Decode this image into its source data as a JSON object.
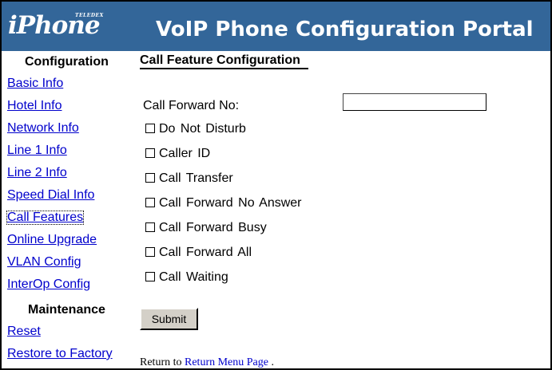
{
  "header": {
    "logo_brand": "iPhone",
    "logo_sub": "TELEDEX",
    "title": "VoIP Phone Configuration Portal",
    "background": "#336699"
  },
  "sidebar": {
    "config_heading": "Configuration",
    "config_links": [
      {
        "label": "Basic Info"
      },
      {
        "label": "Hotel Info"
      },
      {
        "label": "Network Info"
      },
      {
        "label": "Line 1 Info"
      },
      {
        "label": "Line 2 Info"
      },
      {
        "label": "Speed Dial Info"
      },
      {
        "label": "Call Features",
        "active": true
      },
      {
        "label": "Online Upgrade"
      },
      {
        "label": "VLAN Config"
      },
      {
        "label": "InterOp Config"
      }
    ],
    "maint_heading": "Maintenance",
    "maint_links": [
      {
        "label": "Reset"
      },
      {
        "label": "Restore to Factory"
      }
    ],
    "link_color": "#0000cc"
  },
  "main": {
    "heading": "Call Feature Configuration",
    "forward_label": "Call Forward No:",
    "forward_value": "",
    "options": [
      {
        "label": "Do Not Disturb",
        "checked": false
      },
      {
        "label": "Caller ID",
        "checked": false
      },
      {
        "label": "Call Transfer",
        "checked": false
      },
      {
        "label": "Call  Forward No Answer",
        "checked": false
      },
      {
        "label": "Call  Forward Busy",
        "checked": false
      },
      {
        "label": "Call  Forward All",
        "checked": false
      },
      {
        "label": "Call  Waiting",
        "checked": false
      }
    ],
    "submit_label": "Submit",
    "return_prefix": "Return to",
    "return_link": "Return Menu Page",
    "return_suffix": "."
  }
}
